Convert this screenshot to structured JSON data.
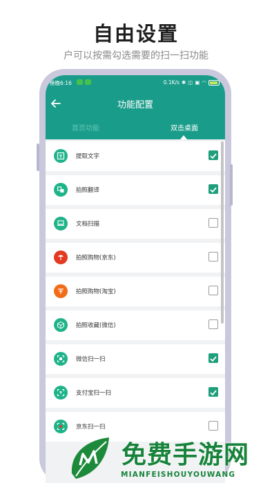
{
  "promo": {
    "title": "自由设置",
    "subtitle": "户可以按需勾选需要的扫一扫功能"
  },
  "status_bar": {
    "time": "傍晚6:16",
    "network": "0.1K/s",
    "icons": [
      "bluetooth-icon",
      "vibrate-icon",
      "sim-icon",
      "wifi-icon",
      "battery-icon"
    ],
    "battery": "100"
  },
  "app_bar": {
    "title": "功能配置",
    "back_icon": "arrow-left-icon",
    "color": "#1a9c8a"
  },
  "tabs": [
    {
      "label": "首页功能",
      "selected": false
    },
    {
      "label": "双击桌面",
      "selected": true
    }
  ],
  "items": [
    {
      "label": "提取文字",
      "checked": true,
      "icon": "text-extract-icon",
      "color": "#1fb38a"
    },
    {
      "label": "拍照翻译",
      "checked": true,
      "icon": "translate-icon",
      "color": "#1fb38a"
    },
    {
      "label": "文档扫描",
      "checked": false,
      "icon": "scanner-icon",
      "color": "#1fb38a"
    },
    {
      "label": "拍照购物(京东)",
      "checked": false,
      "icon": "jd-icon",
      "color": "#e23b22"
    },
    {
      "label": "拍照购物(淘宝)",
      "checked": false,
      "icon": "taobao-icon",
      "color": "#f26b17"
    },
    {
      "label": "拍照收藏(微信)",
      "checked": false,
      "icon": "box-icon",
      "color": "#1fb38a"
    },
    {
      "label": "微信扫一扫",
      "checked": true,
      "icon": "wechat-scan-icon",
      "color": "#1fb38a"
    },
    {
      "label": "支付宝扫一扫",
      "checked": true,
      "icon": "alipay-scan-icon",
      "color": "#1fb38a"
    },
    {
      "label": "京东扫一扫",
      "checked": false,
      "icon": "jd-scan-icon",
      "color": "#1fb38a"
    }
  ],
  "watermark": {
    "text": "免费手游网",
    "pinyin": "MIANFEISHOUYOUWANG",
    "logo": "leaf-m-logo"
  }
}
